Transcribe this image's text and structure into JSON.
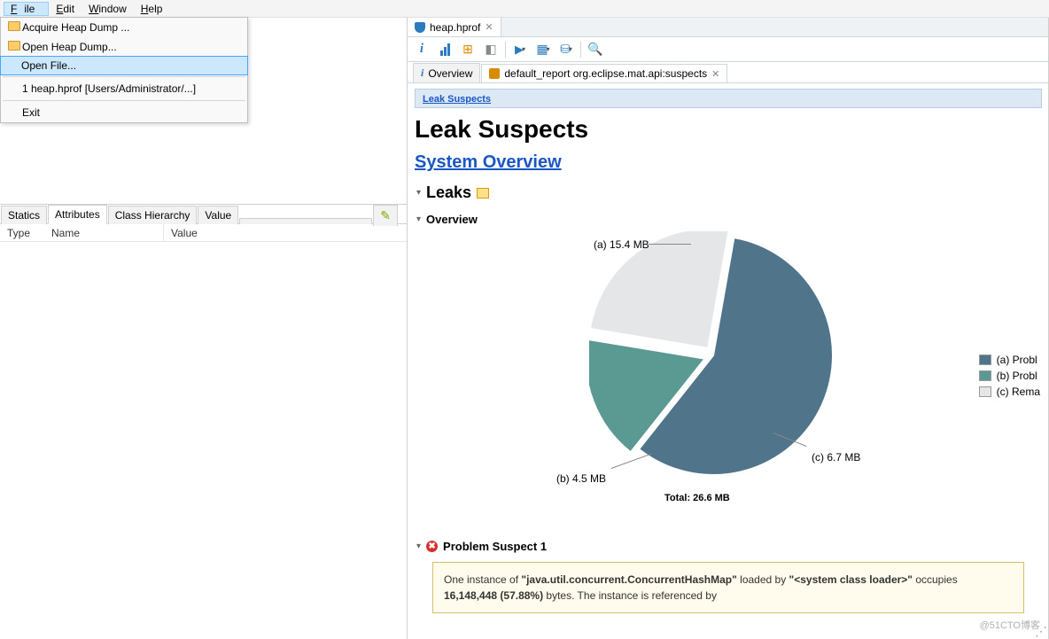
{
  "menu": {
    "file": "File",
    "edit": "Edit",
    "window": "Window",
    "help": "Help"
  },
  "file_menu": {
    "acquire": "Acquire Heap Dump ...",
    "open_heap": "Open Heap Dump...",
    "open_file": "Open File...",
    "recent": "1  heap.hprof  [Users/Administrator/...]",
    "exit": "Exit"
  },
  "left_tabs": {
    "statics": "Statics",
    "attributes": "Attributes",
    "class_hierarchy": "Class Hierarchy",
    "value": "Value"
  },
  "left_cols": {
    "type": "Type",
    "name": "Name",
    "value": "Value"
  },
  "editor_tab": "heap.hprof",
  "inner_tabs": {
    "overview": "Overview",
    "default_report": "default_report  org.eclipse.mat.api:suspects"
  },
  "nav": {
    "leak_suspects": "Leak Suspects"
  },
  "report": {
    "title": "Leak Suspects",
    "system_overview": "System Overview",
    "leaks": "Leaks",
    "overview": "Overview",
    "problem_suspect_1": "Problem Suspect 1",
    "suspect_text_1": "One instance of ",
    "suspect_class": "\"java.util.concurrent.ConcurrentHashMap\"",
    "suspect_text_2": " loaded by ",
    "suspect_loader": "\"<system class loader>\"",
    "suspect_text_3": " occupies ",
    "suspect_bytes": "16,148,448 (57.88%)",
    "suspect_text_4": " bytes. The instance is referenced by"
  },
  "chart_data": {
    "type": "pie",
    "total_label": "Total: 26.6 MB",
    "slices": [
      {
        "key": "a",
        "label": "(a)  15.4 MB",
        "value": 15.4,
        "color": "#50748a",
        "legend": "(a)  Probl"
      },
      {
        "key": "b",
        "label": "(b)  4.5 MB",
        "value": 4.5,
        "color": "#5b9a92",
        "legend": "(b)  Probl"
      },
      {
        "key": "c",
        "label": "(c)  6.7 MB",
        "value": 6.7,
        "color": "#e4e6e7",
        "legend": "(c)  Rema"
      }
    ]
  },
  "watermark": "@51CTO博客"
}
